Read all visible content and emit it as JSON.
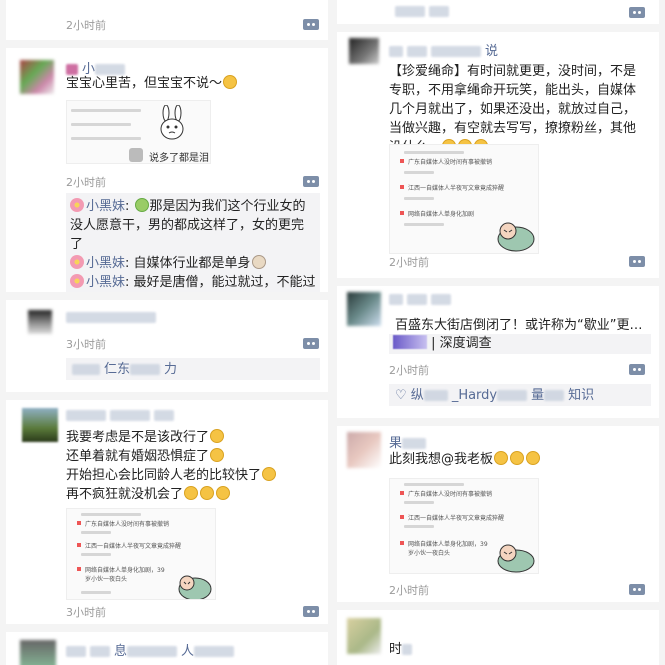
{
  "left": {
    "card1": {
      "time_top": "2小时前",
      "name": "小",
      "text": "宝宝心里苦，但宝宝不说～",
      "sticker_caption": "说多了都是泪",
      "time": "2小时前",
      "comments": [
        {
          "name": "小黑妹",
          "text": "那是因为我们这个行业女的没人愿意干，男的都成这样了，女的更完了"
        },
        {
          "name": "小黑妹",
          "text": "自媒体行业都是单身"
        },
        {
          "name": "小黑妹",
          "text": "最好是唐僧，能过就过，不能过还可以造咯他"
        }
      ]
    },
    "card2": {
      "time": "3小时前",
      "comment_fragment": "仁东",
      "comment_fragment2": "力"
    },
    "card3": {
      "lines": [
        "我要考虑是不是该改行了",
        "还单着就有婚姻恐惧症了",
        "开始担心会比同龄人老的比较快了",
        "再不疯狂就没机会了"
      ],
      "shot_caps": [
        "广东自媒体人没时间有事被撤销",
        "江西一自媒体人半夜写文章竟成猝醒",
        "网络自媒体人单身化加剧，39岁小伙一夜白头"
      ],
      "time": "3小时前"
    },
    "card4": {
      "fragment": "人",
      "fragment2": "息"
    }
  },
  "right": {
    "card1": {
      "name": "说",
      "text": "【珍爱绳命】有时间就更更，没时间，不是专职，不用拿绳命开玩笑，能出头，自媒体几个月就出了，如果还没出，就放过自己，当做兴趣，有空就去写写，撩撩粉丝，其他没什么…",
      "shot_caps": [
        "广东自媒体人没时间有事被撤销",
        "江西一自媒体人半夜写文章竟成猝醒",
        "网络自媒体人单身化加剧"
      ],
      "time": "2小时前"
    },
    "card2": {
      "text": "百盛东大街店倒闭了！或许称为“歇业”更…",
      "link": "| 深度调查",
      "time": "2小时前",
      "likes": "_Hardy",
      "likes_prefix": "纵",
      "likes_suffix": "知识",
      "likes_mid": "量"
    },
    "card3": {
      "name": "果",
      "text": "此刻我想@我老板",
      "shot_caps": [
        "广东自媒体人没时间有事被撤销",
        "江西一自媒体人半夜写文章竟成猝醒",
        "网络自媒体人单身化加剧，39岁小伙一夜白头"
      ],
      "time": "2小时前"
    },
    "card4": {
      "fragment": "时"
    }
  },
  "colors": {
    "link_blue": "#576b95",
    "time_gray": "#9b9b9b",
    "comment_bg": "#f3f3f5"
  },
  "icons": [
    "comment-more-icon",
    "heart-icon",
    "laugh-emoji-icon",
    "flower-icon",
    "dog-emoji-icon",
    "rabbit-sticker",
    "crying-character-sticker"
  ]
}
